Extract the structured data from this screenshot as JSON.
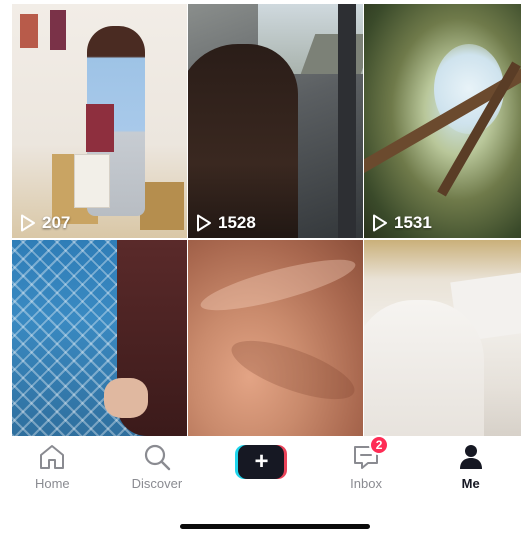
{
  "grid": {
    "videos": [
      {
        "views": "207"
      },
      {
        "views": "1528"
      },
      {
        "views": "1531"
      },
      {
        "views": ""
      },
      {
        "views": ""
      },
      {
        "views": ""
      }
    ]
  },
  "tabbar": {
    "home": {
      "label": "Home",
      "icon": "home-icon"
    },
    "discover": {
      "label": "Discover",
      "icon": "search-icon"
    },
    "create": {
      "label": "+",
      "icon": "plus-icon"
    },
    "inbox": {
      "label": "Inbox",
      "icon": "inbox-icon",
      "badge": "2"
    },
    "me": {
      "label": "Me",
      "icon": "person-icon"
    }
  },
  "colors": {
    "badge": "#fe2c55",
    "create_cyan": "#20d5ec",
    "create_pink": "#ea4359",
    "active_tab": "#161823",
    "inactive_tab": "#8a8b91"
  }
}
